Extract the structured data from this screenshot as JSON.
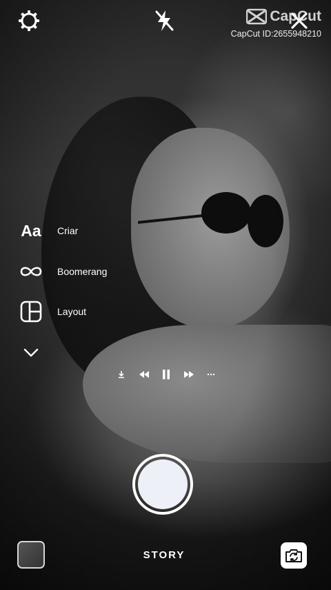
{
  "top_bar": {
    "settings_icon": "gear-icon",
    "flash_icon": "flash-off-icon",
    "close_icon": "close-icon"
  },
  "watermark": {
    "brand": "CapCut",
    "id_text": "CapCut ID:2655948210"
  },
  "side_menu": {
    "create": {
      "icon_text": "Aa",
      "label": "Criar"
    },
    "boomerang": {
      "icon": "infinity-icon",
      "label": "Boomerang"
    },
    "layout": {
      "icon": "layout-grid-icon",
      "label": "Layout"
    },
    "more_icon": "chevron-down-icon"
  },
  "media_controls": [
    "download-icon",
    "rewind-icon",
    "pause-icon",
    "fast-forward-icon",
    "more-icon"
  ],
  "bottom_bar": {
    "mode_label": "STORY",
    "gallery_icon": "gallery-thumbnail",
    "flip_icon": "camera-flip-icon"
  },
  "colors": {
    "text": "#ffffff",
    "shutter_fill": "#eef0f8"
  }
}
